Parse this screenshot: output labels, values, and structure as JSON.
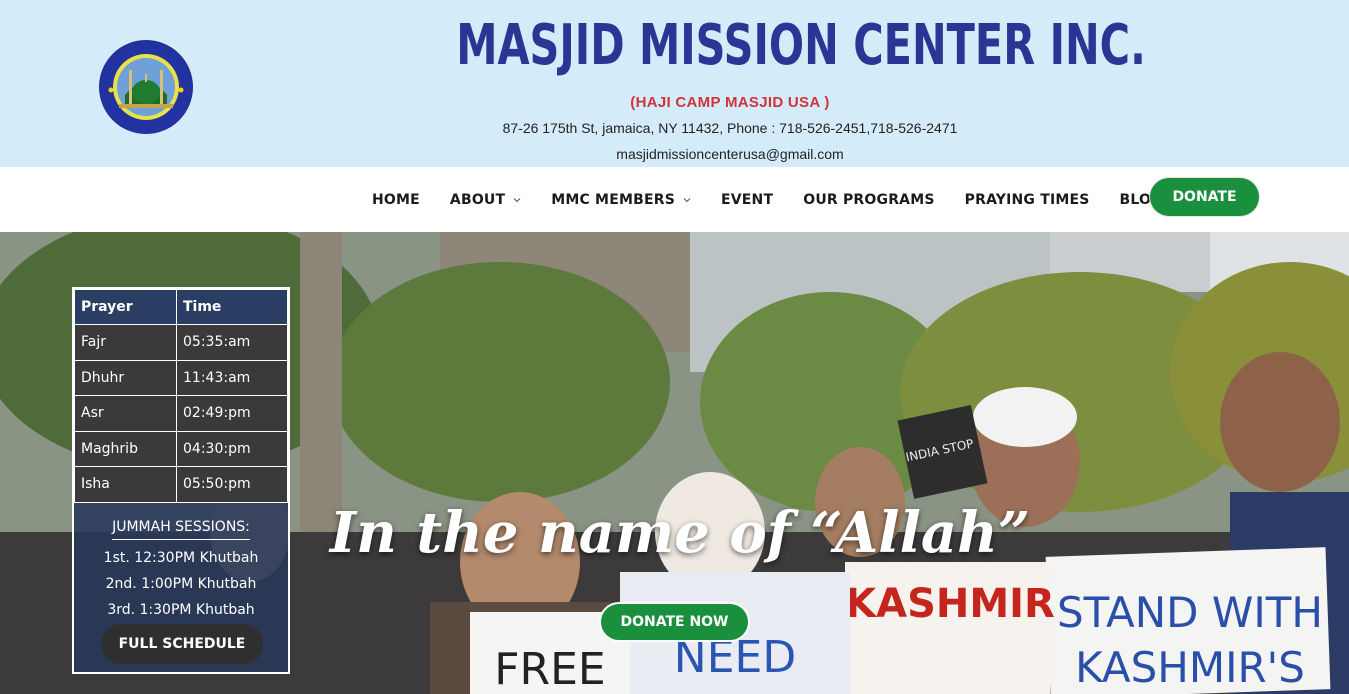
{
  "header": {
    "title": "MASJID MISSION CENTER INC.",
    "subtitle": "(HAJI CAMP MASJID USA )",
    "address": "87-26 175th St, jamaica, NY 11432, Phone : 718-526-2451,718-526-2471",
    "email": "masjidmissioncenterusa@gmail.com",
    "logo": {
      "ring_text": "Masjid Mission Center",
      "bottom_text": "HCM USA",
      "icon": "mosque-logo-icon"
    }
  },
  "nav": {
    "items": [
      {
        "label": "HOME",
        "has_dropdown": false
      },
      {
        "label": "ABOUT",
        "has_dropdown": true
      },
      {
        "label": "MMC MEMBERS",
        "has_dropdown": true
      },
      {
        "label": "EVENT",
        "has_dropdown": false
      },
      {
        "label": "OUR PROGRAMS",
        "has_dropdown": false
      },
      {
        "label": "PRAYING TIMES",
        "has_dropdown": false
      },
      {
        "label": "BLOG",
        "has_dropdown": true
      }
    ],
    "donate_label": "DONATE"
  },
  "hero": {
    "title": "In the name of “Allah”",
    "donate_label": "DONATE NOW",
    "signs": [
      "STAND WITH",
      "KASHMIR'S",
      "KASHMIR",
      "FREE",
      "NEED",
      "INDIA STOP"
    ]
  },
  "prayer": {
    "headers": [
      "Prayer",
      "Time"
    ],
    "rows": [
      {
        "name": "Fajr",
        "time": "05:35:am"
      },
      {
        "name": "Dhuhr",
        "time": "11:43:am"
      },
      {
        "name": "Asr",
        "time": "02:49:pm"
      },
      {
        "name": "Maghrib",
        "time": "04:30:pm"
      },
      {
        "name": "Isha",
        "time": "05:50:pm"
      }
    ],
    "jummah_title": "JUMMAH SESSIONS:",
    "jummah_lines": [
      "1st. 12:30PM Khutbah",
      "2nd. 1:00PM Khutbah",
      "3rd. 1:30PM Khutbah"
    ],
    "schedule_label": "FULL SCHEDULE"
  },
  "colors": {
    "header_bg": "#d4ecfa",
    "title": "#2b3594",
    "subtitle": "#d0343c",
    "brand_green": "#1a8f3e"
  }
}
